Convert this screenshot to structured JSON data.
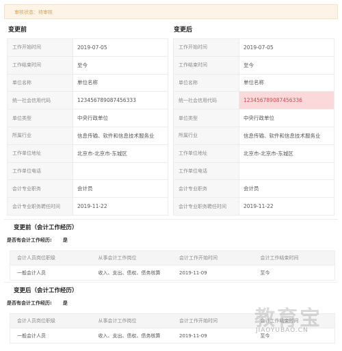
{
  "status": {
    "text": "审核状态：待审核"
  },
  "before": {
    "title": "变更前",
    "rows": [
      {
        "label": "工作开始时间",
        "value": "2019-07-05"
      },
      {
        "label": "工作结束时间",
        "value": "至今"
      },
      {
        "label": "单位名称",
        "value": "单位名称"
      },
      {
        "label": "统一社会信用代码",
        "value": "123456789087456333"
      },
      {
        "label": "单位类型",
        "value": "中央行政单位"
      },
      {
        "label": "所属行业",
        "value": "信息传输、软件和信息技术服务业"
      },
      {
        "label": "工作单位地址",
        "value": "北京市-北京市-东城区"
      },
      {
        "label": "工作单位电话",
        "value": ""
      },
      {
        "label": "会计专业职务",
        "value": "会计员"
      },
      {
        "label": "会计专业职务聘任时间",
        "value": "2019-11-22"
      }
    ]
  },
  "after": {
    "title": "变更后",
    "rows": [
      {
        "label": "工作开始时间",
        "value": "2019-07-05"
      },
      {
        "label": "工作结束时间",
        "value": "至今"
      },
      {
        "label": "单位名称",
        "value": "单位名称"
      },
      {
        "label": "统一社会信用代码",
        "value": "123456789087456336",
        "highlight": true
      },
      {
        "label": "单位类型",
        "value": "中央行政单位"
      },
      {
        "label": "所属行业",
        "value": "信息传输、软件和信息技术服务业"
      },
      {
        "label": "工作单位地址",
        "value": "北京市-北京市-东城区"
      },
      {
        "label": "工作单位电话",
        "value": ""
      },
      {
        "label": "会计专业职务",
        "value": "会计员"
      },
      {
        "label": "会计专业职务聘任时间",
        "value": "2019-11-22"
      }
    ]
  },
  "exp_before": {
    "title": "变更前（会计工作经历）",
    "question": "是否有会计工作经历:",
    "answer": "是",
    "headers": [
      "会计人员岗位职级",
      "从事会计工作岗位",
      "会计工作开始时间",
      "会计工作结束时间"
    ],
    "row": [
      "一般会计人员",
      "收入、支出、债权、债务核算",
      "2019-11-09",
      "至今"
    ]
  },
  "exp_after": {
    "title": "变更后（会计工作经历）",
    "question": "是否有会计工作经历:",
    "answer": "是",
    "headers": [
      "会计人员岗位职级",
      "从事会计工作岗位",
      "会计工作开始时间",
      "会计工作结束时间"
    ],
    "row": [
      "一般会计人员",
      "收入、支出、债权、债务核算",
      "2019-11-09",
      "至今"
    ]
  },
  "watermark": {
    "cn": "教育宝",
    "en": "JIAOYUBAO.CN"
  },
  "colors": {
    "highlight_bg": "#fbd9da",
    "highlight_text": "#c64b52",
    "status_bg": "#fdf3e6",
    "status_text": "#d9a45c"
  }
}
